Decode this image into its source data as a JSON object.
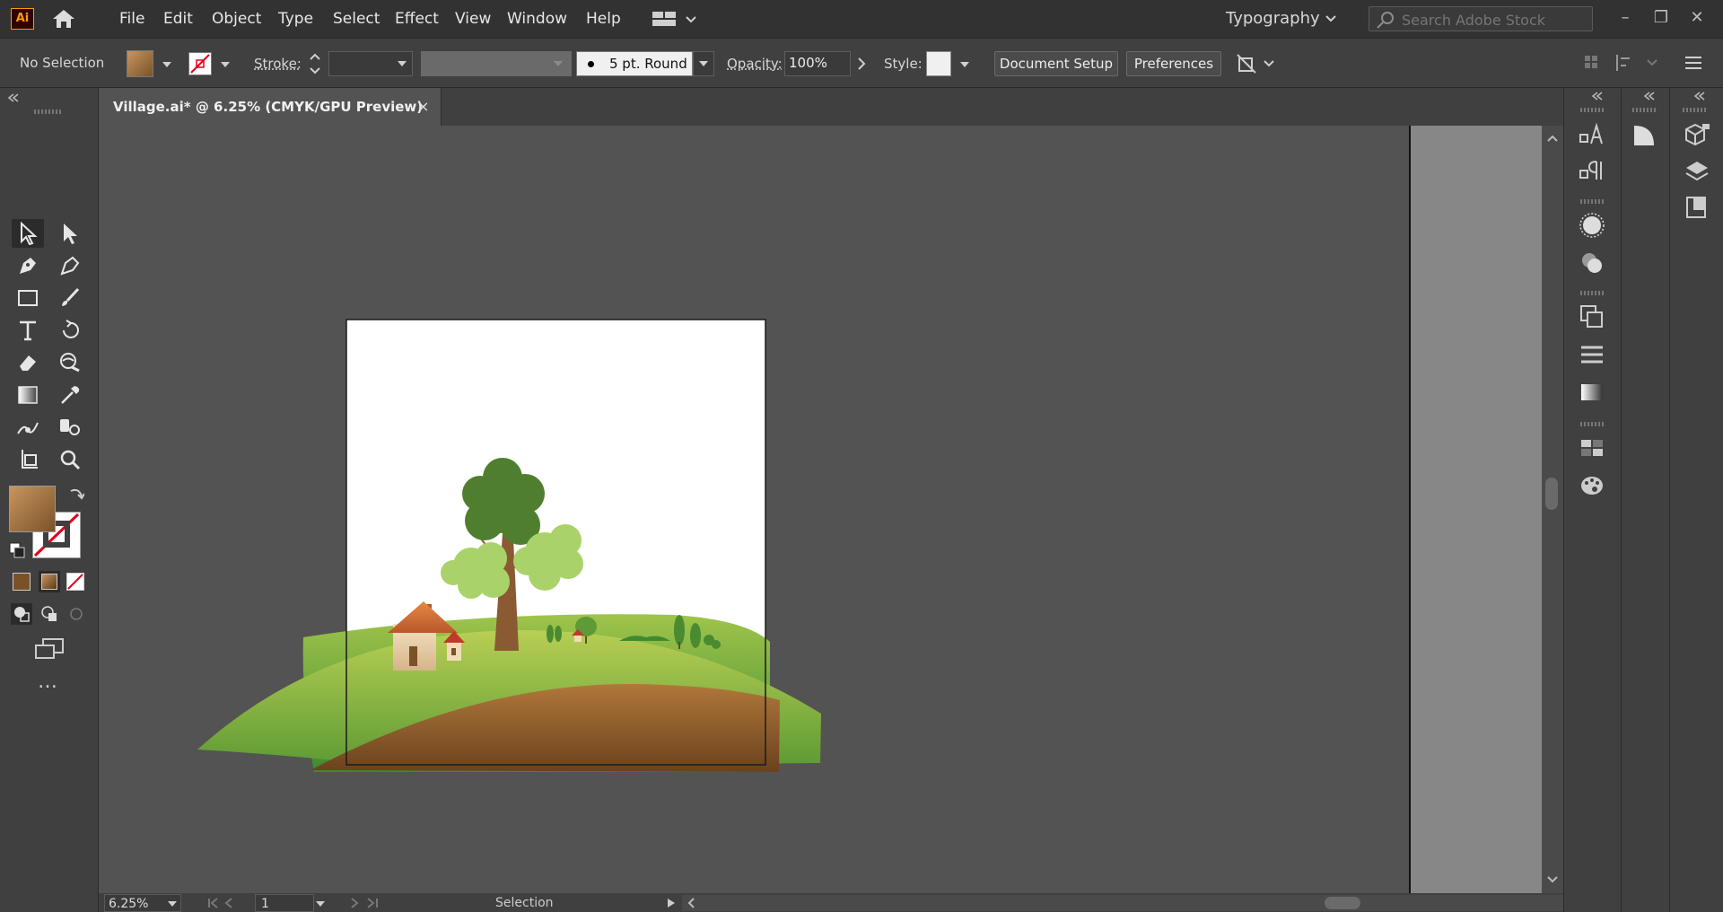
{
  "app": {
    "logo": "Ai",
    "home_icon": "home-icon"
  },
  "menu": [
    "File",
    "Edit",
    "Object",
    "Type",
    "Select",
    "Effect",
    "View",
    "Window",
    "Help"
  ],
  "workspace": {
    "label": "Typography"
  },
  "search": {
    "placeholder": "Search Adobe Stock"
  },
  "control": {
    "selection_status": "No Selection",
    "stroke_label": "Stroke:",
    "brush_label": "5 pt. Round",
    "opacity_label": "Opacity:",
    "opacity_value": "100%",
    "style_label": "Style:",
    "document_setup": "Document Setup",
    "preferences": "Preferences"
  },
  "document": {
    "tab_title": "Village.ai* @ 6.25% (CMYK/GPU Preview)",
    "close": "×"
  },
  "status": {
    "zoom": "6.25%",
    "artboard": "1",
    "tool": "Selection"
  },
  "colors": {
    "fill": "#a87a4a",
    "accent": "#ff9a00",
    "grass": "#6fa63a",
    "soil": "#8a5a2a"
  }
}
